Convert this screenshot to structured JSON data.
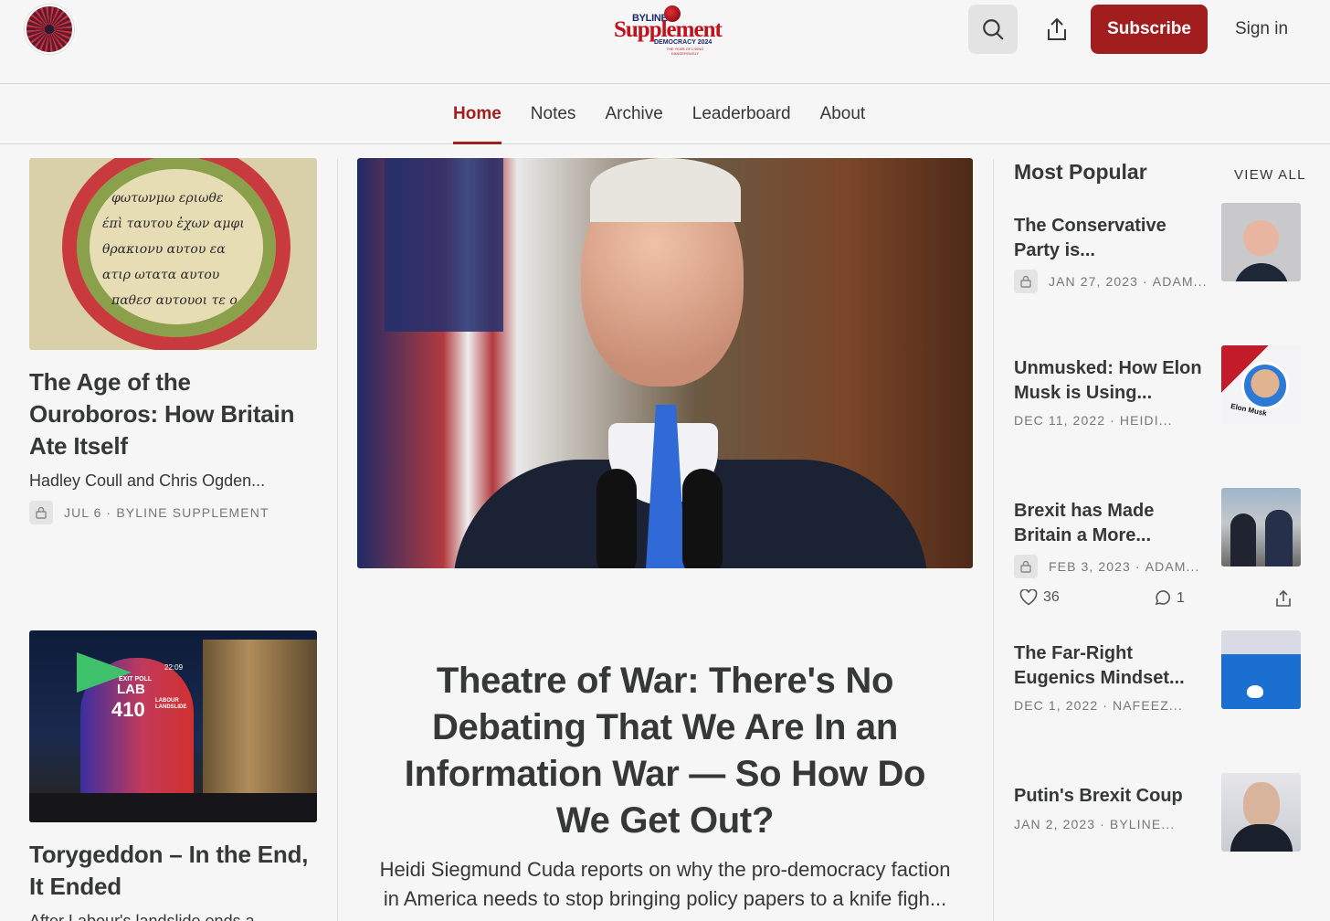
{
  "header": {
    "logo": {
      "small": "BYLINE",
      "main": "Supplement",
      "sub": "DEMOCRACY 2024",
      "tag": "THE YEAR OF LIVING DANGEROUSLY"
    },
    "subscribe_label": "Subscribe",
    "signin_label": "Sign in",
    "icons": {
      "search": "search-icon",
      "share": "share-icon"
    },
    "accent_color": "#a21e1e"
  },
  "nav": {
    "tabs": [
      {
        "label": "Home",
        "active": true
      },
      {
        "label": "Notes",
        "active": false
      },
      {
        "label": "Archive",
        "active": false
      },
      {
        "label": "Leaderboard",
        "active": false
      },
      {
        "label": "About",
        "active": false
      }
    ]
  },
  "left": {
    "posts": [
      {
        "title": "The Age of the Ouroboros: How Britain Ate Itself",
        "subtitle": "Hadley Coull and Chris Ogden...",
        "date": "JUL 6",
        "author": "BYLINE SUPPLEMENT",
        "image_text": {
          "lab": "LAB",
          "seats": "410",
          "exit_poll": "EXIT POLL"
        }
      },
      {
        "title": "Torygeddon – In the End, It Ended",
        "subtitle": "After Labour's landslide ends a..."
      }
    ],
    "image_text": {
      "exit_poll": "EXIT POLL",
      "lab": "LAB",
      "seats": "410",
      "time": "22:09",
      "landslide": "LABOUR LANDSLIDE"
    }
  },
  "feature": {
    "title": "Theatre of War: There's No Debating That We Are In an Information War — So How Do We Get Out?",
    "subtitle": "Heidi Siegmund Cuda reports on why the pro-democracy faction in America needs to stop bringing policy papers to a knife figh..."
  },
  "popular": {
    "heading": "Most Popular",
    "view_all": "VIEW ALL",
    "items": [
      {
        "title": "The Conservative Party is...",
        "date": "JAN 27, 2023",
        "author": "ADAM...",
        "locked": true
      },
      {
        "title": "Unmusked: How Elon Musk is Using...",
        "date": "DEC 11, 2022",
        "author": "HEIDI...",
        "locked": false,
        "thumb_text": "Elon Musk"
      },
      {
        "title": "Brexit has Made Britain a More...",
        "date": "FEB 3, 2023",
        "author": "ADAM...",
        "locked": true,
        "likes": "36",
        "comments": "1"
      },
      {
        "title": "The Far-Right Eugenics Mindset...",
        "date": "DEC 1, 2022",
        "author": "NAFEEZ...",
        "locked": false
      },
      {
        "title": "Putin's Brexit Coup",
        "date": "JAN 2, 2023",
        "author": "BYLINE...",
        "locked": false
      }
    ]
  }
}
